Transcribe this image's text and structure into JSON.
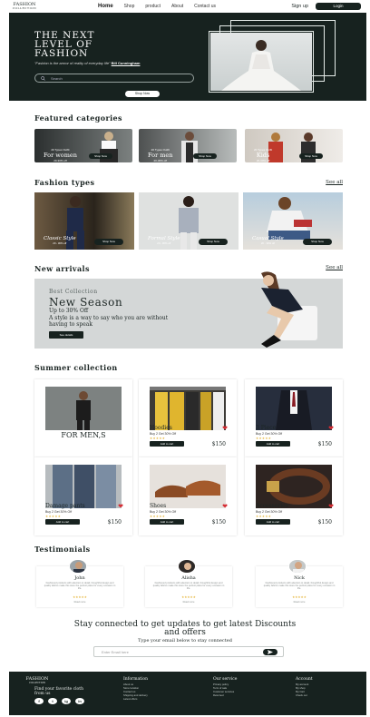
{
  "header": {
    "logo_main": "FASHION",
    "logo_sub": "COLLECTION",
    "nav": [
      "Home",
      "Shop",
      "product",
      "About",
      "Contact us"
    ],
    "signup": "Sign up",
    "login": "Login"
  },
  "hero": {
    "title": "THE NEXT LEVEL OF FASHION",
    "tagline": "\"Fashion is the armor of reality of everyday life\"",
    "author": "Bill Cunningham",
    "search_placeholder": "Search",
    "shop_now": "Shop Now"
  },
  "featured": {
    "title": "Featured categories",
    "cards": [
      {
        "small": "20 Types Outfit",
        "label": "For women",
        "sub": "20-30% off",
        "btn": "Shop Now"
      },
      {
        "small": "20 Types Outfit",
        "label": "For men",
        "sub": "20-30% off",
        "btn": "Shop Now"
      },
      {
        "small": "20 Types Outfit",
        "label": "Kids",
        "sub": "20-30% off",
        "btn": "Shop Now"
      }
    ]
  },
  "fashion_types": {
    "title": "Fashion types",
    "see_all": "See all",
    "cards": [
      {
        "label": "Classic Style",
        "sub": "20 - 30% off",
        "btn": "Shop Now"
      },
      {
        "label": "Formal Style",
        "sub": "20 - 30% off",
        "btn": "Shop Now"
      },
      {
        "label": "Casual Style",
        "sub": "20 - 30% off",
        "btn": "Shop Now"
      }
    ]
  },
  "arrivals": {
    "title": "New arrivals",
    "see_all": "See all",
    "best": "Best Collection",
    "season": "New Season",
    "off": "Up to 30% Off",
    "say": "A style is a way to say who you are without having to speak",
    "btn": "See details"
  },
  "summer": {
    "title": "Summer collection",
    "for_men": "FOR MEN,S",
    "products": [
      {
        "name": "Hoodies",
        "deal": "Buy 2 Get 30% Off",
        "stars": "★★★★★",
        "cart": "Add to cart",
        "price": "$150"
      },
      {
        "name": "3 Piece",
        "deal": "Buy 2 Get 30% Off",
        "stars": "★★★★★",
        "cart": "Add to cart",
        "price": "$150"
      },
      {
        "name": "Damage pants",
        "deal": "Buy 2 Get 30% Off",
        "stars": "★★★★★",
        "cart": "Add to cart",
        "price": "$150"
      },
      {
        "name": "Shoes",
        "deal": "Buy 2 Get 30% Off",
        "stars": "★★★★★",
        "cart": "Add to cart",
        "price": "$150"
      },
      {
        "name": "Accessories",
        "deal": "Buy 2 Get 30% Off",
        "stars": "★★★★★",
        "cart": "Add to cart",
        "price": "$150"
      }
    ]
  },
  "testimonials": {
    "title": "Testimonials",
    "items": [
      {
        "name": "John",
        "text": "Fashioned products with attention to detail, thoughtful design and quality fabrics make this store the perfect place for every occasion in life.",
        "stars": "★★★★★",
        "more": "Read more"
      },
      {
        "name": "Alisha",
        "text": "Fashioned products with attention to detail, thoughtful design and quality fabrics make this store the perfect place for every occasion in life.",
        "stars": "★★★★★",
        "more": "Read more"
      },
      {
        "name": "Nick",
        "text": "Fashioned products with attention to detail, thoughtful design and quality fabrics make this store the perfect place for every occasion in life.",
        "stars": "★★★★★",
        "more": "Read more"
      }
    ]
  },
  "subscribe": {
    "title": "Stay connected to get updates to get latest Discounts and offers",
    "subtitle": "Type your email below to stay connected",
    "placeholder": "Enter Email here"
  },
  "footer": {
    "logo_main": "FASHION",
    "logo_sub": "COLLECTION",
    "find": "Find your favorite cloth from us",
    "social": [
      "f",
      "t",
      "ig",
      "in"
    ],
    "columns": [
      {
        "head": "Information",
        "links": [
          "About us",
          "Store location",
          "Contact us",
          "Shipping and delivery",
          "Latest offers"
        ]
      },
      {
        "head": "Our service",
        "links": [
          "Privacy policy",
          "Term of sale",
          "Customer services",
          "Returned"
        ]
      },
      {
        "head": "Account",
        "links": [
          "My account",
          "My shop",
          "My Cart",
          "Check out"
        ]
      }
    ]
  }
}
